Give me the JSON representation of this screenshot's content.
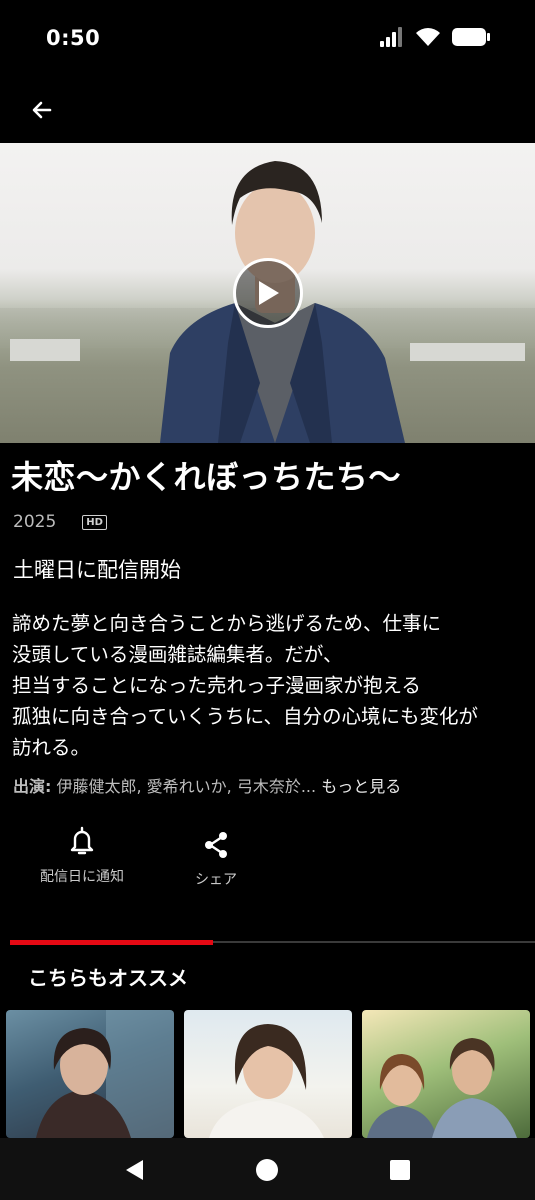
{
  "status_bar": {
    "time": "0:50"
  },
  "show": {
    "title": "未恋〜かくれぼっちたち〜",
    "year": "2025",
    "quality_badge": "HD",
    "release_note": "土曜日に配信開始",
    "synopsis_lines": [
      "諦めた夢と向き合うことから逃げるため、仕事に",
      "没頭している漫画雑誌編集者。だが、",
      "担当することになった売れっ子漫画家が抱える",
      "孤独に向き合っていくうちに、自分の心境にも変化が",
      "訪れる。"
    ],
    "cast_label": "出演:",
    "cast_names": " 伊藤健太郎, 愛希れいか, 弓木奈於...",
    "cast_more": " もっと見る"
  },
  "actions": {
    "notify_label": "配信日に通知",
    "share_label": "シェア"
  },
  "tabs": {
    "recommend_label": "こちらもオススメ"
  },
  "colors": {
    "accent": "#e50914",
    "background": "#000000"
  },
  "icons": {
    "back": "arrow-left-icon",
    "play": "play-icon",
    "notify": "bell-icon",
    "share": "share-icon",
    "nav_back": "triangle-back-icon",
    "nav_home": "circle-home-icon",
    "nav_recents": "square-recents-icon"
  }
}
